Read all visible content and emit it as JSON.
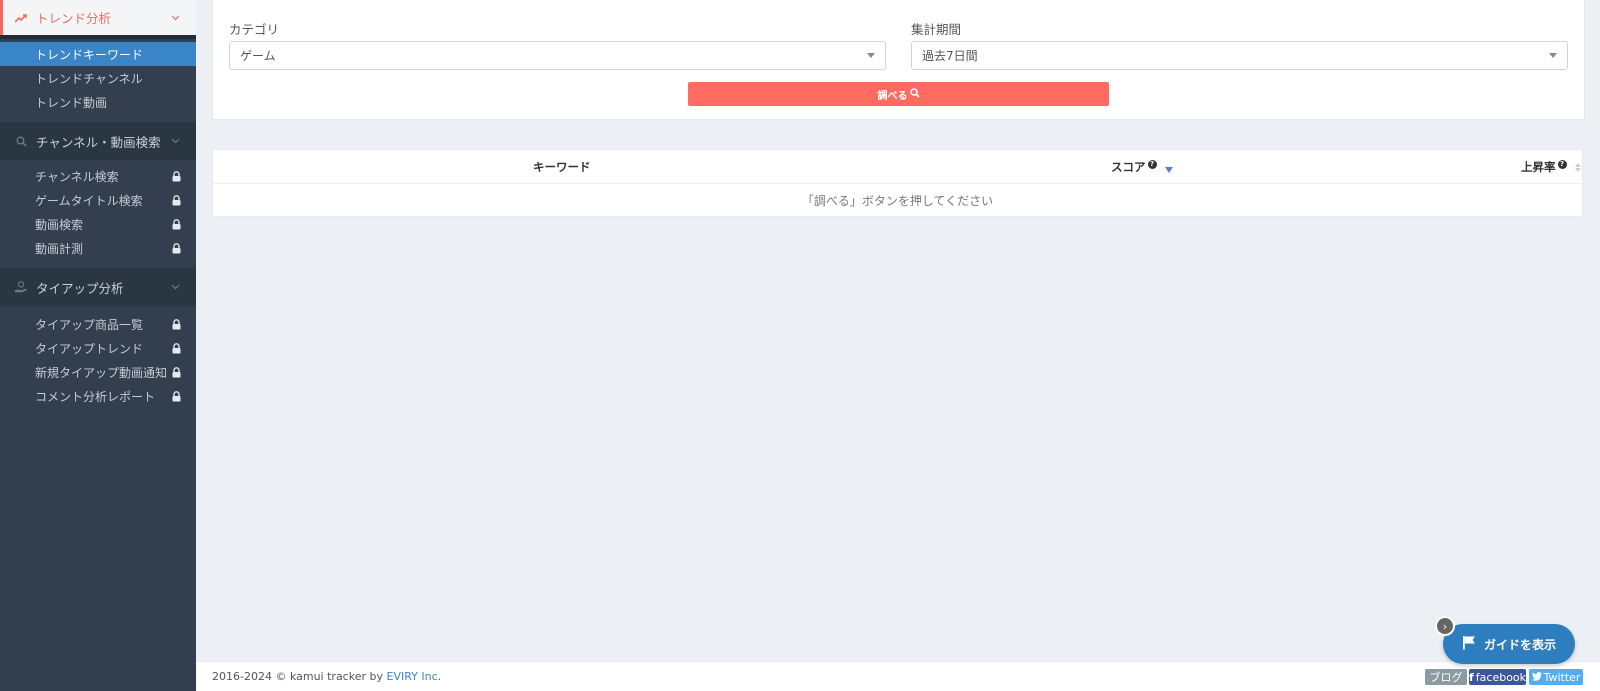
{
  "sidebar": {
    "trend_section": {
      "label": "トレンド分析"
    },
    "trend_items": [
      {
        "label": "トレンドキーワード",
        "active": true
      },
      {
        "label": "トレンドチャンネル"
      },
      {
        "label": "トレンド動画"
      }
    ],
    "channel_section": {
      "label": "チャンネル・動画検索"
    },
    "channel_items": [
      {
        "label": "チャンネル検索"
      },
      {
        "label": "ゲームタイトル検索"
      },
      {
        "label": "動画検索"
      },
      {
        "label": "動画計測"
      }
    ],
    "tieup_section": {
      "label": "タイアップ分析"
    },
    "tieup_items": [
      {
        "label": "タイアップ商品一覧"
      },
      {
        "label": "タイアップトレンド"
      },
      {
        "label": "新規タイアップ動画通知"
      },
      {
        "label": "コメント分析レポート"
      }
    ]
  },
  "filters": {
    "category_label": "カテゴリ",
    "category_value": "ゲーム",
    "period_label": "集計期間",
    "period_value": "過去7日間",
    "search_button": "調べる"
  },
  "table": {
    "col_keyword": "キーワード",
    "col_score": "スコア",
    "col_rise": "上昇率",
    "help_mark": "?",
    "empty_message": "「調べる」ボタンを押してください"
  },
  "footer": {
    "copyright": "2016-2024 © kamui tracker by ",
    "company": "EVIRY Inc",
    "period": ".",
    "blog": "ブログ",
    "facebook": "facebook",
    "twitter": "Twitter"
  },
  "guide": {
    "button_label": "ガイドを表示",
    "close_glyph": "›"
  },
  "colors": {
    "accent": "#f06b5d",
    "sidebar_bg": "#333f4e",
    "active_item": "#3a85c8",
    "search_button": "#ff6b61",
    "guide_button": "#2d7dbf"
  }
}
